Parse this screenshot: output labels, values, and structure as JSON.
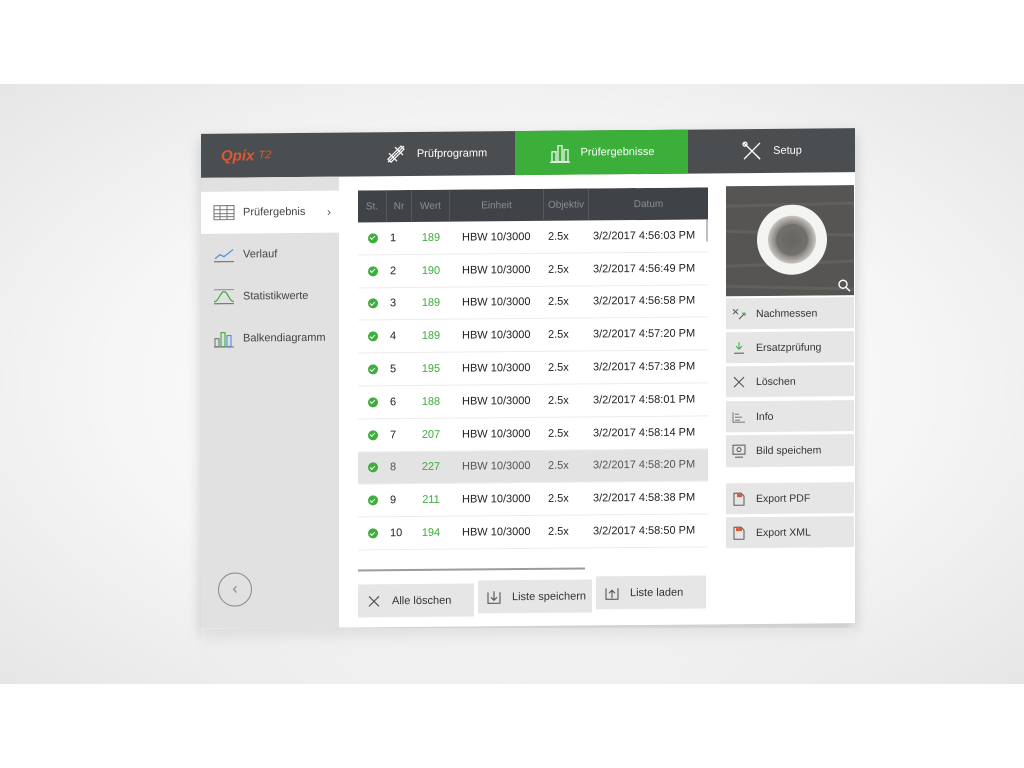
{
  "app": {
    "logo_main": "Qpix",
    "logo_sub": "T2"
  },
  "tabs": [
    {
      "label": "Prüfprogramm",
      "icon": "ruler-pencil-icon"
    },
    {
      "label": "Prüfergebnisse",
      "icon": "bar-chart-icon",
      "active": true
    },
    {
      "label": "Setup",
      "icon": "tools-icon"
    }
  ],
  "sidebar": {
    "items": [
      {
        "label": "Prüfergebnis",
        "icon": "table-icon",
        "active": true,
        "chevron": "›"
      },
      {
        "label": "Verlauf",
        "icon": "line-chart-icon"
      },
      {
        "label": "Statistikwerte",
        "icon": "distribution-curve-icon"
      },
      {
        "label": "Balkendiagramm",
        "icon": "bar-chart-icon"
      }
    ],
    "back_glyph": "‹"
  },
  "table": {
    "columns": [
      "St.",
      "Nr",
      "Wert",
      "Einheit",
      "Objektiv",
      "Datum"
    ],
    "rows": [
      {
        "nr": "1",
        "wert": "189",
        "einheit": "HBW 10/3000",
        "objektiv": "2.5x",
        "datum": "3/2/2017 4:56:03 PM"
      },
      {
        "nr": "2",
        "wert": "190",
        "einheit": "HBW 10/3000",
        "objektiv": "2.5x",
        "datum": "3/2/2017 4:56:49 PM"
      },
      {
        "nr": "3",
        "wert": "189",
        "einheit": "HBW 10/3000",
        "objektiv": "2.5x",
        "datum": "3/2/2017 4:56:58 PM"
      },
      {
        "nr": "4",
        "wert": "189",
        "einheit": "HBW 10/3000",
        "objektiv": "2.5x",
        "datum": "3/2/2017 4:57:20 PM"
      },
      {
        "nr": "5",
        "wert": "195",
        "einheit": "HBW 10/3000",
        "objektiv": "2.5x",
        "datum": "3/2/2017 4:57:38 PM"
      },
      {
        "nr": "6",
        "wert": "188",
        "einheit": "HBW 10/3000",
        "objektiv": "2.5x",
        "datum": "3/2/2017 4:58:01 PM"
      },
      {
        "nr": "7",
        "wert": "207",
        "einheit": "HBW 10/3000",
        "objektiv": "2.5x",
        "datum": "3/2/2017 4:58:14 PM"
      },
      {
        "nr": "8",
        "wert": "227",
        "einheit": "HBW 10/3000",
        "objektiv": "2.5x",
        "datum": "3/2/2017 4:58:20 PM",
        "selected": true
      },
      {
        "nr": "9",
        "wert": "211",
        "einheit": "HBW 10/3000",
        "objektiv": "2.5x",
        "datum": "3/2/2017 4:58:38 PM"
      },
      {
        "nr": "10",
        "wert": "194",
        "einheit": "HBW 10/3000",
        "objektiv": "2.5x",
        "datum": "3/2/2017 4:58:50 PM"
      }
    ],
    "status_icon": "check-circle-icon"
  },
  "bottom_buttons": [
    {
      "label": "Alle löschen",
      "icon": "close-icon"
    },
    {
      "label": "Liste speichern",
      "icon": "save-list-icon"
    },
    {
      "label": "Liste laden",
      "icon": "load-list-icon"
    }
  ],
  "actions": [
    {
      "label": "Nachmessen",
      "icon": "remeasure-icon"
    },
    {
      "label": "Ersatzprüfung",
      "icon": "replacement-test-icon"
    },
    {
      "label": "Löschen",
      "icon": "close-icon"
    },
    {
      "label": "Info",
      "icon": "info-icon"
    },
    {
      "label": "Bild speichem",
      "icon": "save-image-icon"
    },
    {
      "label": "Export PDF",
      "icon": "pdf-icon"
    },
    {
      "label": "Export XML",
      "icon": "xml-icon"
    }
  ],
  "colors": {
    "header": "#4b4e51",
    "accent_green": "#3cae3a",
    "logo": "#e1562c",
    "sidebar": "#e1e1e1",
    "table_header": "#3f4347"
  }
}
